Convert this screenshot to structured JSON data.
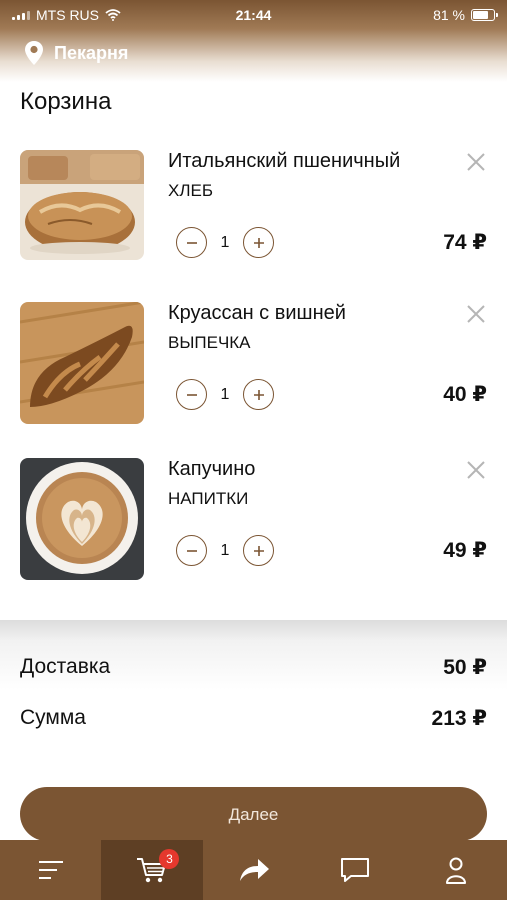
{
  "status_bar": {
    "carrier": "MTS RUS",
    "time": "21:44",
    "battery": "81 %",
    "battery_level": 0.81
  },
  "header": {
    "location_icon": "location-pin-icon",
    "location": "Пекарня"
  },
  "page": {
    "title": "Корзина"
  },
  "cart": {
    "items": [
      {
        "name": "Итальянский пшеничный",
        "category": "ХЛЕБ",
        "quantity": "1",
        "price": "74 ₽",
        "image": "bread-photo"
      },
      {
        "name": "Круассан с вишней",
        "category": "ВЫПЕЧКА",
        "quantity": "1",
        "price": "40 ₽",
        "image": "croissant-photo"
      },
      {
        "name": "Капучино",
        "category": "НАПИТКИ",
        "quantity": "1",
        "price": "49 ₽",
        "image": "cappuccino-photo"
      }
    ]
  },
  "summary": {
    "delivery_label": "Доставка",
    "delivery_value": "50 ₽",
    "total_label": "Сумма",
    "total_value": "213 ₽"
  },
  "next_button": {
    "label": "Далее"
  },
  "tabbar": {
    "items": [
      {
        "icon": "menu-icon"
      },
      {
        "icon": "cart-icon",
        "badge": "3"
      },
      {
        "icon": "share-arrow-icon"
      },
      {
        "icon": "chat-icon"
      },
      {
        "icon": "user-icon"
      }
    ]
  },
  "colors": {
    "brand": "#7b5533",
    "brand_dark": "#5e3f24",
    "badge": "#e5382d"
  }
}
